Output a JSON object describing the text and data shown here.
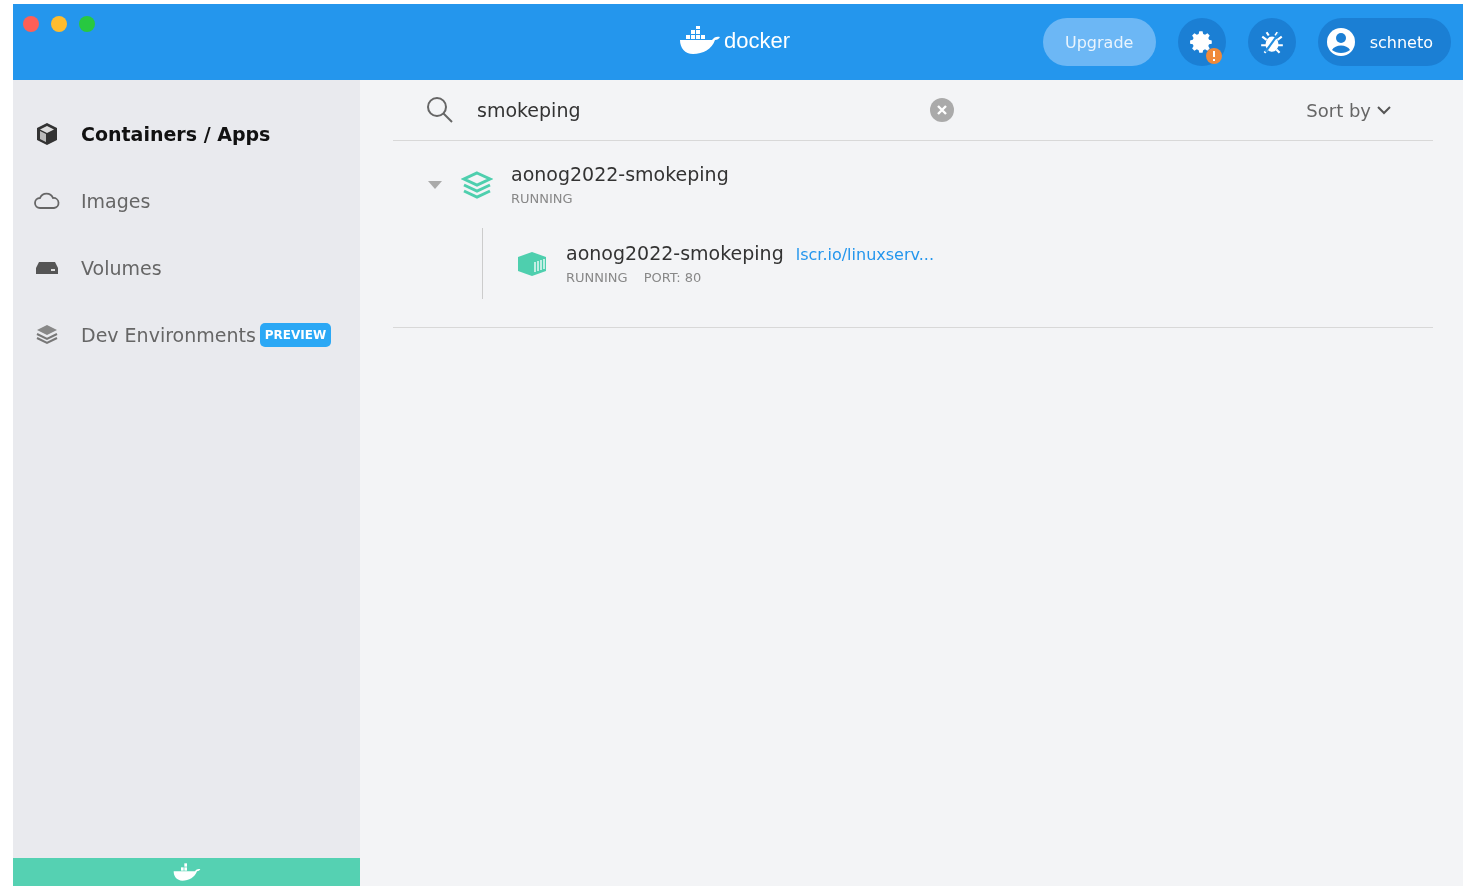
{
  "window": {
    "logo_text": "docker"
  },
  "header": {
    "upgrade_button": "Upgrade",
    "settings_alert": true,
    "user": "schneto"
  },
  "sidebar": {
    "items": [
      {
        "label": "Containers / Apps",
        "selected": true
      },
      {
        "label": "Images",
        "selected": false
      },
      {
        "label": "Volumes",
        "selected": false
      },
      {
        "label": "Dev Environments",
        "selected": false,
        "badge": "PREVIEW"
      }
    ]
  },
  "search": {
    "value": "smokeping"
  },
  "sort": {
    "label": "Sort by"
  },
  "apps": [
    {
      "name": "aonog2022-smokeping",
      "status": "RUNNING",
      "expanded": true,
      "containers": [
        {
          "name": "aonog2022-smokeping",
          "image": "lscr.io/linuxserv...",
          "status": "RUNNING",
          "port": "PORT: 80"
        }
      ]
    }
  ]
}
